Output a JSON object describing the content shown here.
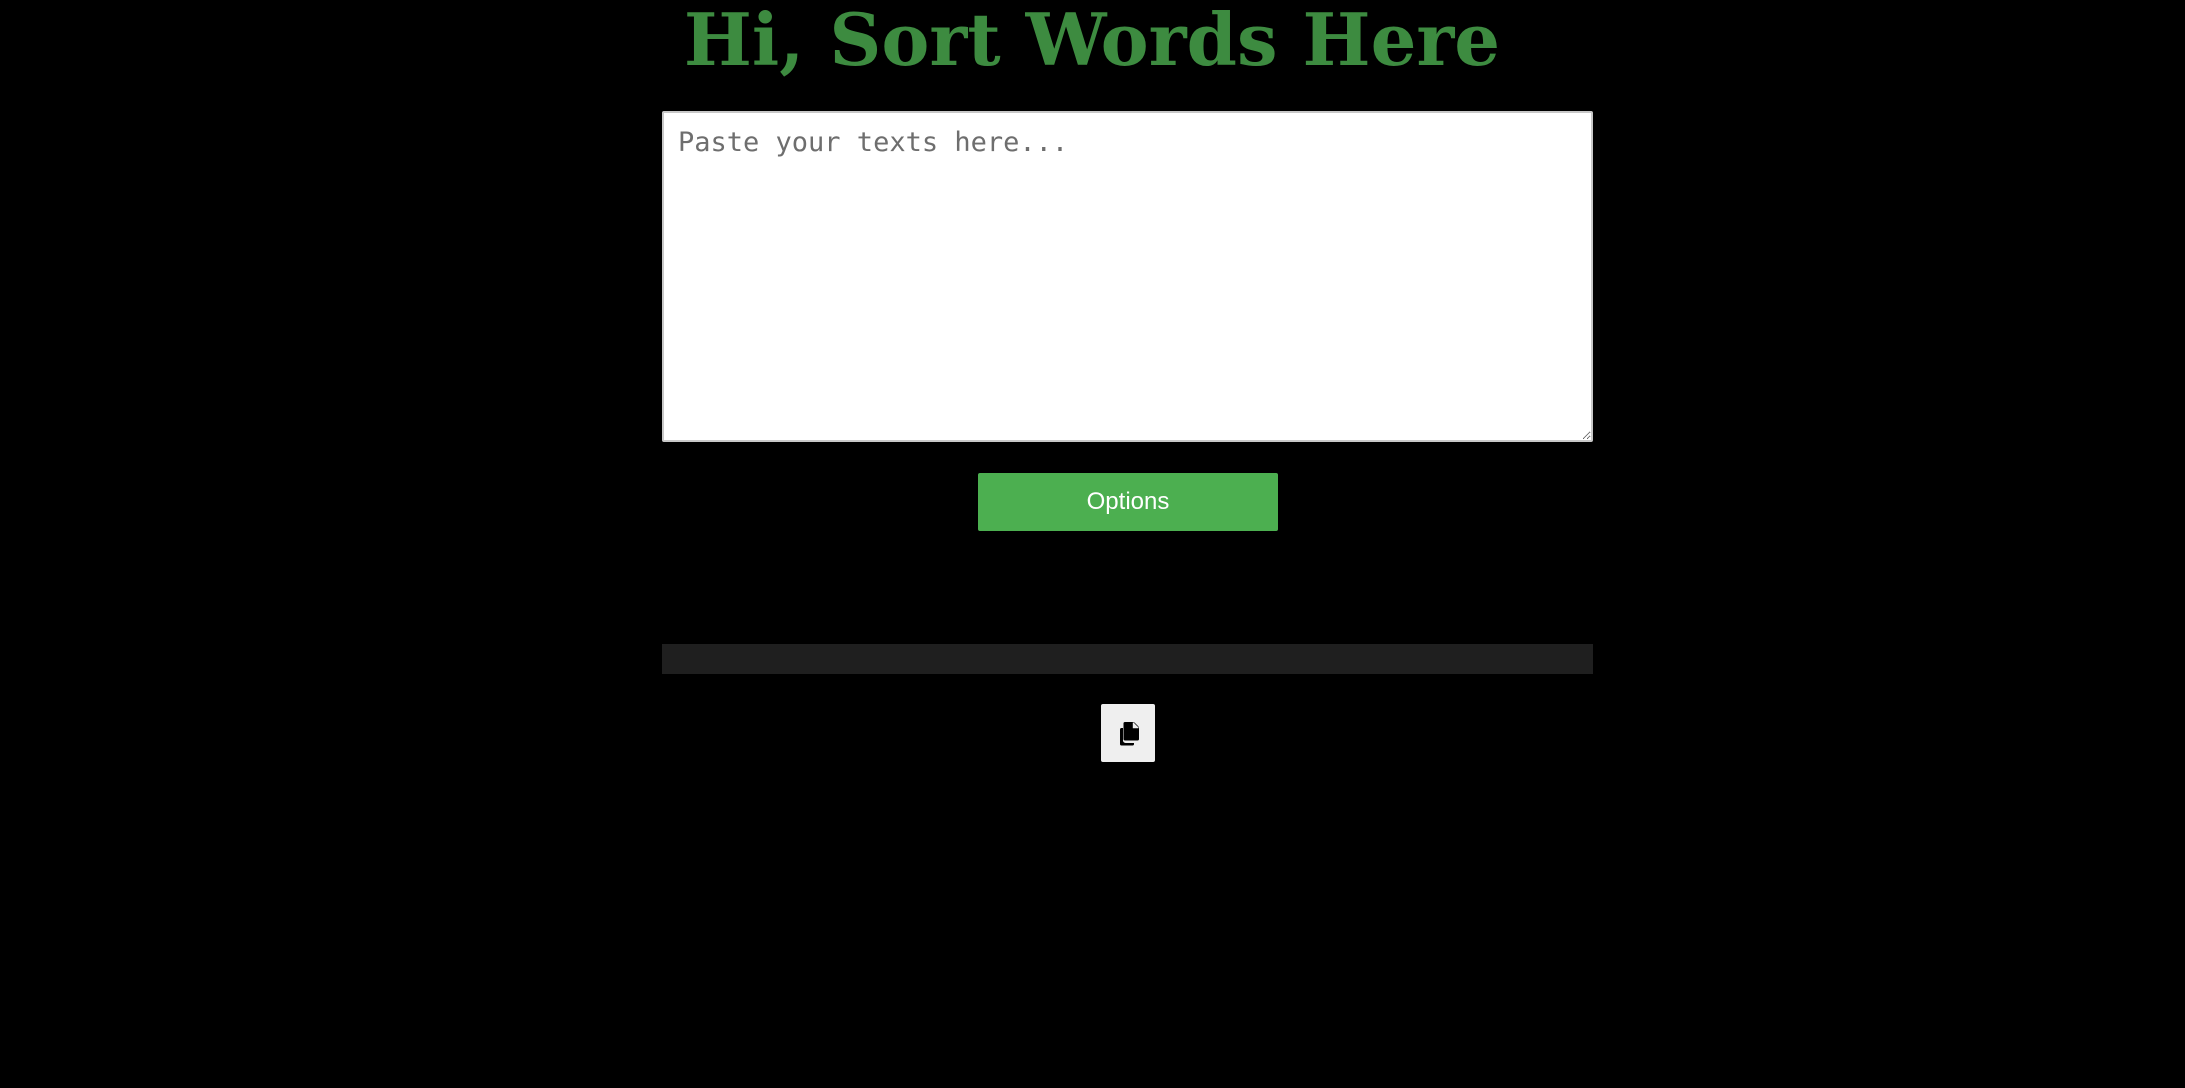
{
  "header": {
    "title": "Hi, Sort Words Here"
  },
  "input": {
    "placeholder": "Paste your texts here...",
    "value": ""
  },
  "options_button": {
    "label": "Options"
  },
  "output": {
    "text": ""
  },
  "copy_button": {
    "icon": "copy-icon"
  },
  "colors": {
    "background": "#000000",
    "title": "#3d8b40",
    "button": "#4caf50",
    "output_bar": "#1f1f1f"
  }
}
